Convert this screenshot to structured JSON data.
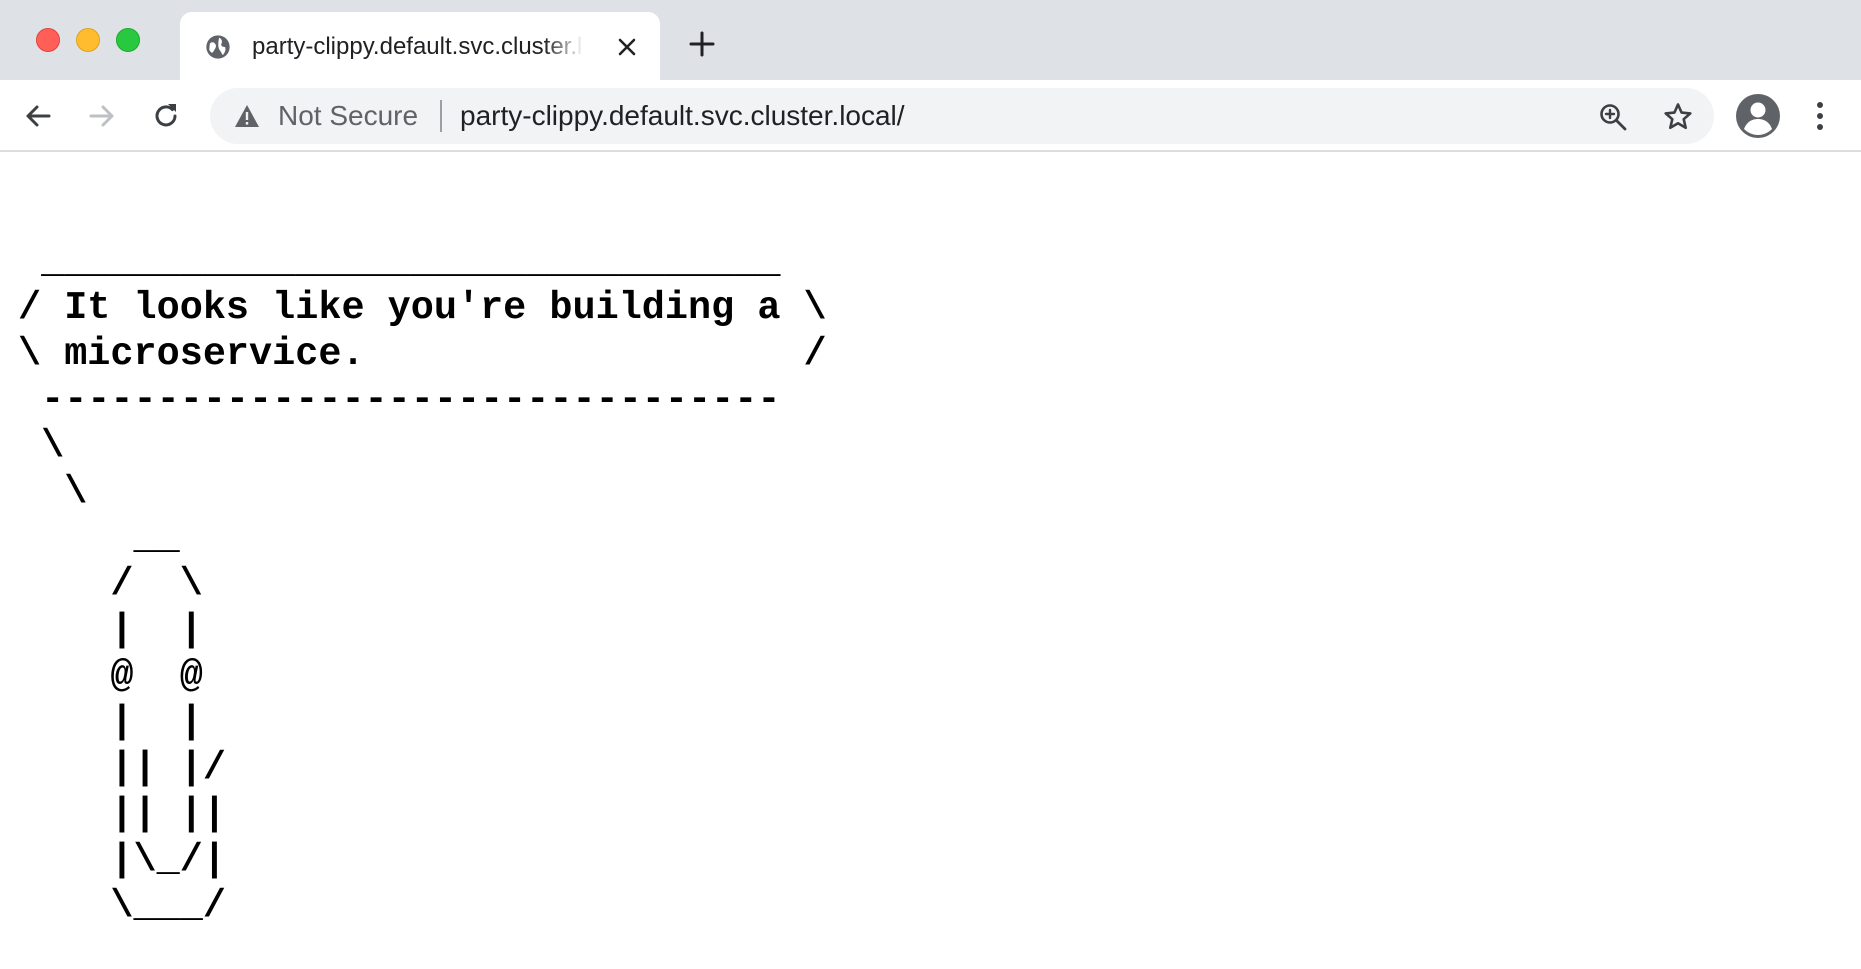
{
  "tab": {
    "title": "party-clippy.default.svc.cluster.local/",
    "favicon": "globe-icon"
  },
  "toolbar": {
    "security_label": "Not Secure",
    "url": "party-clippy.default.svc.cluster.local/"
  },
  "page": {
    "ascii_art": " ________________________________\n/ It looks like you're building a \\\n\\ microservice.                   /\n --------------------------------\n \\\n  \\\n     __\n    /  \\\n    |  |\n    @  @\n    |  |\n    || |/\n    || ||\n    |\\_/|\n    \\___/"
  },
  "colors": {
    "tabstrip_bg": "#dee1e6",
    "omnibox_bg": "#f1f3f4",
    "close": "#ff5f57",
    "minimize": "#febc2e",
    "maximize": "#28c840"
  }
}
